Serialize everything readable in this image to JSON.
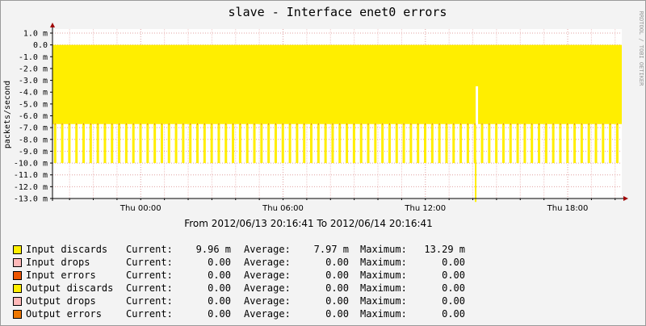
{
  "chart_data": {
    "type": "area",
    "title": "slave - Interface enet0 errors",
    "ylabel": "packets/second",
    "subtitle": "From 2012/06/13 20:16:41 To 2012/06/14 20:16:41",
    "watermark": "RRDTOOL / TOBI OETIKER",
    "ylim": [
      -13.0,
      1.0
    ],
    "y_ticks": [
      {
        "value": 1,
        "label": "1.0 m"
      },
      {
        "value": 0,
        "label": "0.0"
      },
      {
        "value": -1,
        "label": "-1.0 m"
      },
      {
        "value": -2,
        "label": "-2.0 m"
      },
      {
        "value": -3,
        "label": "-3.0 m"
      },
      {
        "value": -4,
        "label": "-4.0 m"
      },
      {
        "value": -5,
        "label": "-5.0 m"
      },
      {
        "value": -6,
        "label": "-6.0 m"
      },
      {
        "value": -7,
        "label": "-7.0 m"
      },
      {
        "value": -8,
        "label": "-8.0 m"
      },
      {
        "value": -9,
        "label": "-9.0 m"
      },
      {
        "value": -10,
        "label": "-10.0 m"
      },
      {
        "value": -11,
        "label": "-11.0 m"
      },
      {
        "value": -12,
        "label": "-12.0 m"
      },
      {
        "value": -13,
        "label": "-13.0 m"
      }
    ],
    "x_range_hours": [
      -3.72,
      20.28
    ],
    "x_ticks": [
      {
        "value": 0,
        "label": "Thu 00:00"
      },
      {
        "value": 6,
        "label": "Thu 06:00"
      },
      {
        "value": 12,
        "label": "Thu 12:00"
      },
      {
        "value": 18,
        "label": "Thu 18:00"
      }
    ],
    "fill_color": "#ffee00",
    "series": [
      {
        "name": "Input discards",
        "fill_top": 0.0,
        "base_level": -6.7,
        "spike_level": -10.0,
        "spike_period_hours": 0.3,
        "gap": {
          "hours": 14.12,
          "width_hours": 0.07,
          "level": -13.29,
          "top": -3.5
        }
      }
    ],
    "legend": [
      {
        "name": "Input discards",
        "color": "#ffee00",
        "current": "9.96 m",
        "average": "7.97 m",
        "maximum": "13.29 m"
      },
      {
        "name": "Input drops",
        "color": "#ffb8b8",
        "current": "0.00",
        "average": "0.00",
        "maximum": "0.00"
      },
      {
        "name": "Input errors",
        "color": "#ee5500",
        "current": "0.00",
        "average": "0.00",
        "maximum": "0.00"
      },
      {
        "name": "Output discards",
        "color": "#ffee00",
        "current": "0.00",
        "average": "0.00",
        "maximum": "0.00"
      },
      {
        "name": "Output drops",
        "color": "#ffb8b8",
        "current": "0.00",
        "average": "0.00",
        "maximum": "0.00"
      },
      {
        "name": "Output errors",
        "color": "#ee7700",
        "current": "0.00",
        "average": "0.00",
        "maximum": "0.00"
      }
    ],
    "legend_labels": {
      "current": "Current:",
      "average": "Average:",
      "maximum": "Maximum:"
    }
  }
}
